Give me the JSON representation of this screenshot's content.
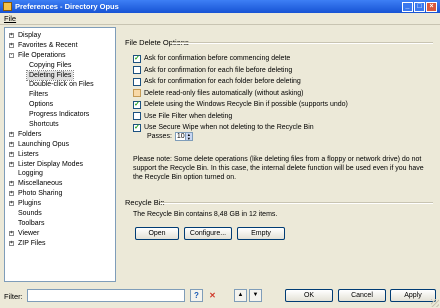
{
  "window": {
    "title": "Preferences - Directory Opus"
  },
  "menu": {
    "file": "File"
  },
  "tree": [
    {
      "label": "Display",
      "exp": "+",
      "indent": 0
    },
    {
      "label": "Favorites & Recent",
      "exp": "+",
      "indent": 0
    },
    {
      "label": "File Operations",
      "exp": "-",
      "indent": 0
    },
    {
      "label": "Copying Files",
      "exp": "",
      "indent": 1
    },
    {
      "label": "Deleting Files",
      "exp": "",
      "indent": 1,
      "selected": true
    },
    {
      "label": "Double-click on Files",
      "exp": "",
      "indent": 1
    },
    {
      "label": "Filters",
      "exp": "",
      "indent": 1
    },
    {
      "label": "Options",
      "exp": "",
      "indent": 1
    },
    {
      "label": "Progress Indicators",
      "exp": "",
      "indent": 1
    },
    {
      "label": "Shortcuts",
      "exp": "",
      "indent": 1
    },
    {
      "label": "Folders",
      "exp": "+",
      "indent": 0
    },
    {
      "label": "Launching Opus",
      "exp": "+",
      "indent": 0
    },
    {
      "label": "Listers",
      "exp": "+",
      "indent": 0
    },
    {
      "label": "Lister Display Modes",
      "exp": "+",
      "indent": 0
    },
    {
      "label": "Logging",
      "exp": "",
      "indent": 0
    },
    {
      "label": "Miscellaneous",
      "exp": "+",
      "indent": 0
    },
    {
      "label": "Photo Sharing",
      "exp": "+",
      "indent": 0
    },
    {
      "label": "Plugins",
      "exp": "+",
      "indent": 0
    },
    {
      "label": "Sounds",
      "exp": "",
      "indent": 0
    },
    {
      "label": "Toolbars",
      "exp": "",
      "indent": 0
    },
    {
      "label": "Viewer",
      "exp": "+",
      "indent": 0
    },
    {
      "label": "ZIP Files",
      "exp": "+",
      "indent": 0
    }
  ],
  "delete": {
    "group_title": "File Delete Options",
    "options": [
      {
        "label": "Ask for confirmation before commencing delete",
        "checked": true
      },
      {
        "label": "Ask for confirmation for each file before deleting",
        "checked": false
      },
      {
        "label": "Ask for confirmation for each folder before deleting",
        "checked": false
      },
      {
        "label": "Delete read-only files automatically (without asking)",
        "checked": false,
        "highlight": true
      },
      {
        "label": "Delete using the Windows Recycle Bin if possible (supports undo)",
        "checked": true
      },
      {
        "label": "Use File Filter when deleting",
        "checked": false
      },
      {
        "label": "Use Secure Wipe when not deleting to the Recycle Bin",
        "checked": true
      }
    ],
    "passes_label": "Passes:",
    "passes_value": "10",
    "note": "Please note: Some delete operations (like deleting files from a floppy or network drive) do not support the Recycle Bin. In this case, the internal delete function will be used even if you have the Recycle Bin option turned on."
  },
  "recycle": {
    "group_title": "Recycle Bin",
    "info": "The Recycle Bin contains 8,48 GB in 12 items.",
    "open_button": "Open",
    "configure_button": "Configure...",
    "empty_button": "Empty"
  },
  "bottom": {
    "filter_label": "Filter:",
    "filter_value": "",
    "ok_button": "OK",
    "cancel_button": "Cancel",
    "apply_button": "Apply"
  }
}
